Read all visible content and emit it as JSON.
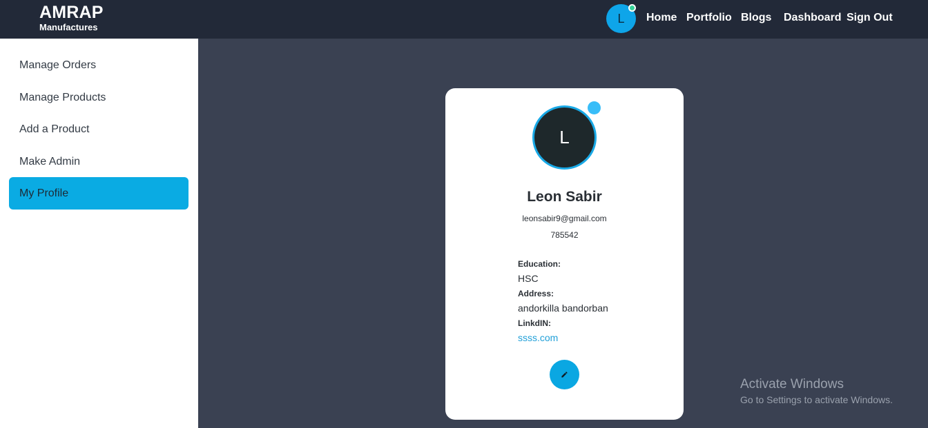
{
  "brand": {
    "title": "AMRAP",
    "subtitle": "Manufactures"
  },
  "navbar": {
    "avatar_initial": "L",
    "links": [
      "Home",
      "Portfolio",
      "Blogs",
      "Dashboard",
      "Sign Out"
    ]
  },
  "sidebar": {
    "items": [
      {
        "label": "Manage Orders",
        "active": false
      },
      {
        "label": "Manage Products",
        "active": false
      },
      {
        "label": "Add a Product",
        "active": false
      },
      {
        "label": "Make Admin",
        "active": false
      },
      {
        "label": "My Profile",
        "active": true
      }
    ]
  },
  "profile": {
    "avatar_initial": "L",
    "name": "Leon Sabir",
    "email": "leonsabir9@gmail.com",
    "phone": "785542",
    "education_label": "Education:",
    "education": "HSC",
    "address_label": "Address:",
    "address": "andorkilla bandorban",
    "linkedin_label": "LinkdIN:",
    "linkedin": "ssss.com",
    "edit_icon": "pencil-icon"
  },
  "watermark": {
    "title": "Activate Windows",
    "subtitle": "Go to Settings to activate Windows."
  },
  "colors": {
    "navbar_bg": "#222938",
    "content_bg": "#3a4152",
    "accent": "#0aabe3",
    "online": "#34d399"
  }
}
